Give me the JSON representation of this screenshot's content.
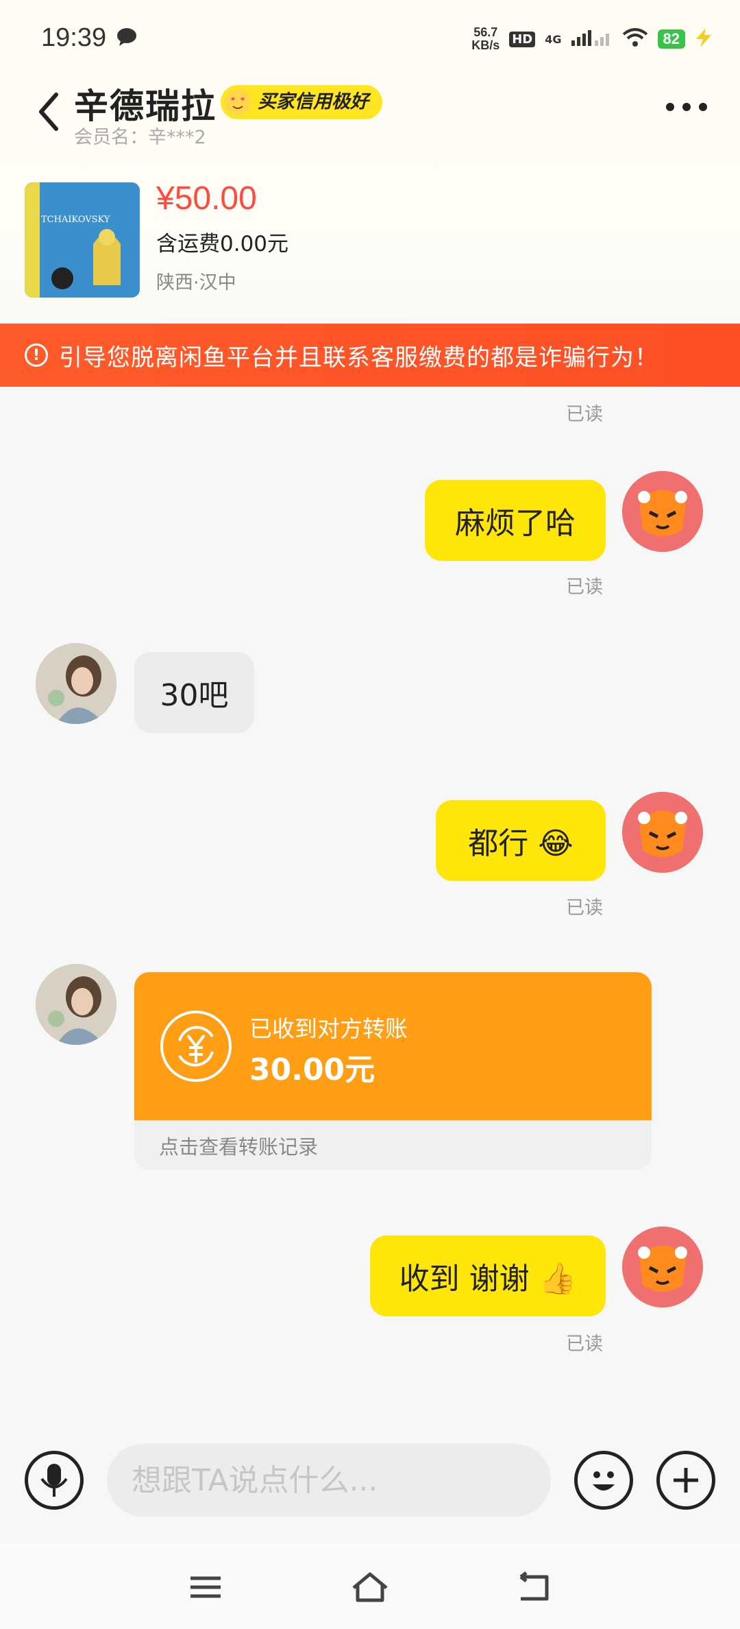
{
  "status_bar": {
    "time": "19:39",
    "net_speed_value": "56.7",
    "net_speed_unit": "KB/s",
    "hd": "HD",
    "network": "4G",
    "battery": "82"
  },
  "header": {
    "seller_name": "辛德瑞拉",
    "credit_badge": "买家信用极好",
    "member_name": "会员名：辛***2"
  },
  "product": {
    "price": "¥50.00",
    "shipping": "含运费0.00元",
    "location": "陕西·汉中",
    "thumb_title": "TCHAIKOVSKY"
  },
  "warning": {
    "text": "引导您脱离闲鱼平台并且联系客服缴费的都是诈骗行为！"
  },
  "messages": [
    {
      "from": "me",
      "text": "麻烦了哈",
      "status": "已读"
    },
    {
      "from": "them",
      "text": "30吧"
    },
    {
      "from": "me",
      "text": "都行 😂",
      "status": "已读"
    },
    {
      "from": "them",
      "type": "transfer",
      "title": "已收到对方转账",
      "amount": "30.00元",
      "link": "点击查看转账记录"
    },
    {
      "from": "me",
      "text": "收到 谢谢 👍",
      "status": "已读"
    }
  ],
  "top_read_status": "已读",
  "input": {
    "placeholder": "想跟TA说点什么..."
  },
  "colors": {
    "accent_yellow": "#ffe60a",
    "price_red": "#ff4b3e",
    "warning_orange": "#ff5a2a",
    "transfer_orange": "#ff9d15"
  }
}
